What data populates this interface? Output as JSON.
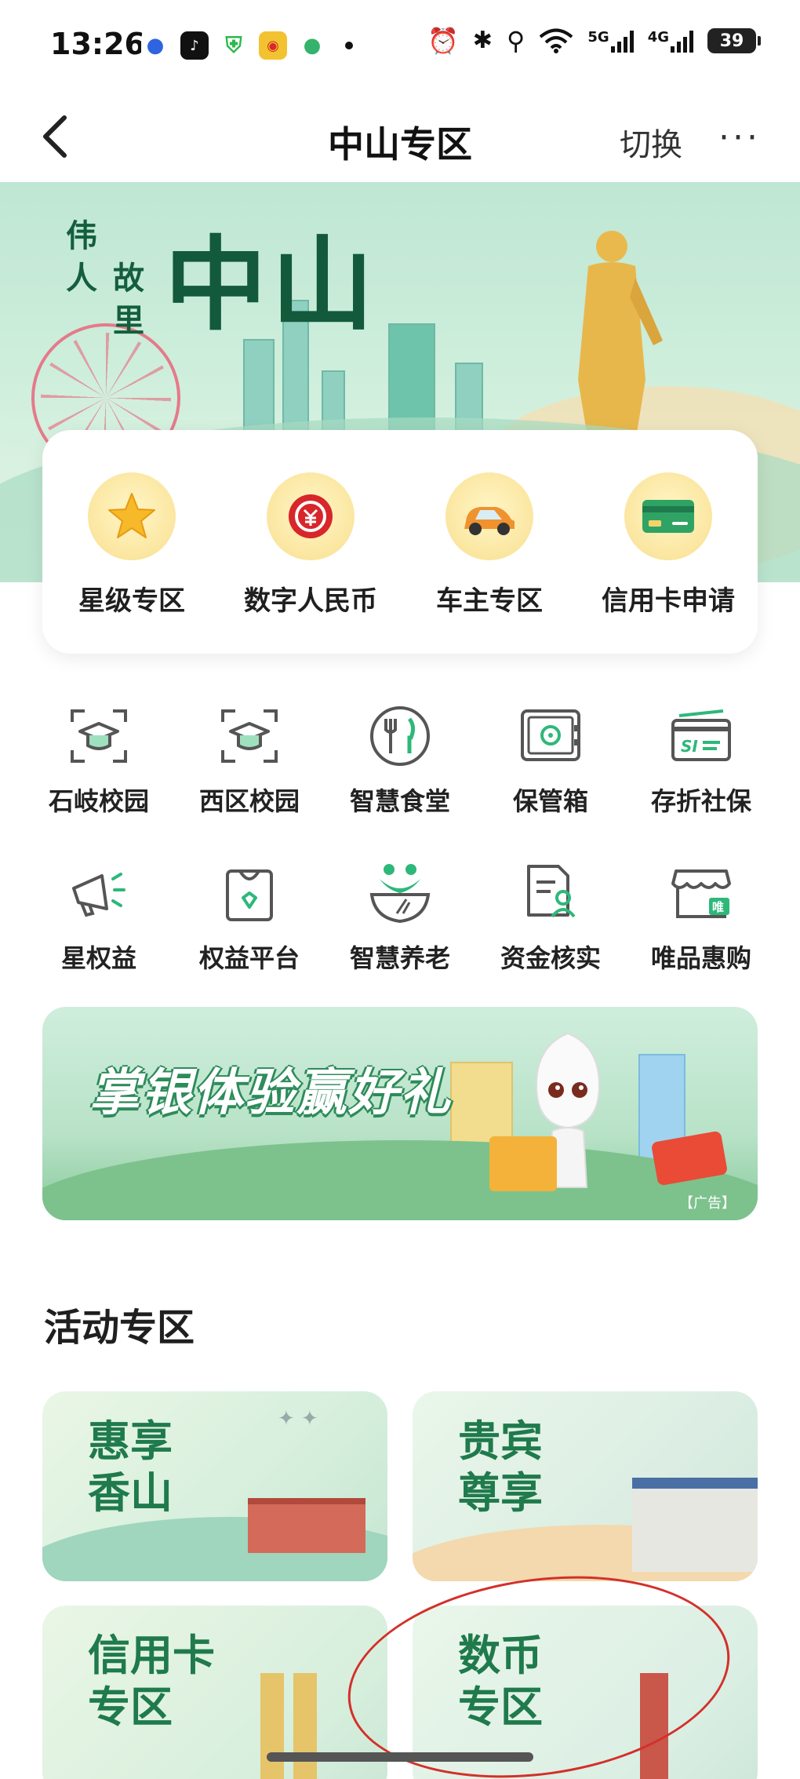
{
  "status_bar": {
    "time": "13:26",
    "net1": "5G",
    "net2": "4G",
    "battery": "39"
  },
  "nav": {
    "back_icon": "chevron-left-icon",
    "title": "中山专区",
    "switch_label": "切换",
    "more_label": "···"
  },
  "hero": {
    "subtitle_chars": [
      "伟",
      "人",
      "故",
      "里"
    ],
    "title": "中山"
  },
  "quick_actions": [
    {
      "label": "星级专区",
      "icon": "star-icon"
    },
    {
      "label": "数字人民币",
      "icon": "digital-rmb-icon"
    },
    {
      "label": "车主专区",
      "icon": "car-icon"
    },
    {
      "label": "信用卡申请",
      "icon": "credit-card-icon"
    }
  ],
  "services": [
    {
      "label": "石岐校园",
      "icon": "campus-cap-icon"
    },
    {
      "label": "西区校园",
      "icon": "campus-cap-icon"
    },
    {
      "label": "智慧食堂",
      "icon": "fork-knife-icon"
    },
    {
      "label": "保管箱",
      "icon": "safe-box-icon"
    },
    {
      "label": "存折社保",
      "icon": "social-security-card-icon"
    },
    {
      "label": "星权益",
      "icon": "megaphone-icon"
    },
    {
      "label": "权益平台",
      "icon": "shopping-bag-icon"
    },
    {
      "label": "智慧养老",
      "icon": "elderly-care-icon"
    },
    {
      "label": "资金核实",
      "icon": "document-user-icon"
    },
    {
      "label": "唯品惠购",
      "icon": "store-icon"
    }
  ],
  "banner": {
    "title": "掌银体验赢好礼",
    "ad_label": "【广告】"
  },
  "activity": {
    "section_title": "活动专区",
    "cards": [
      {
        "line1": "惠享",
        "line2": "香山"
      },
      {
        "line1": "贵宾",
        "line2": "尊享"
      },
      {
        "line1": "信用卡",
        "line2": "专区"
      },
      {
        "line1": "数币",
        "line2": "专区"
      }
    ]
  },
  "colors": {
    "brand_green": "#1f7a4c",
    "hero_bg": "#c6e9d6",
    "annotation_red": "#d3302a"
  }
}
